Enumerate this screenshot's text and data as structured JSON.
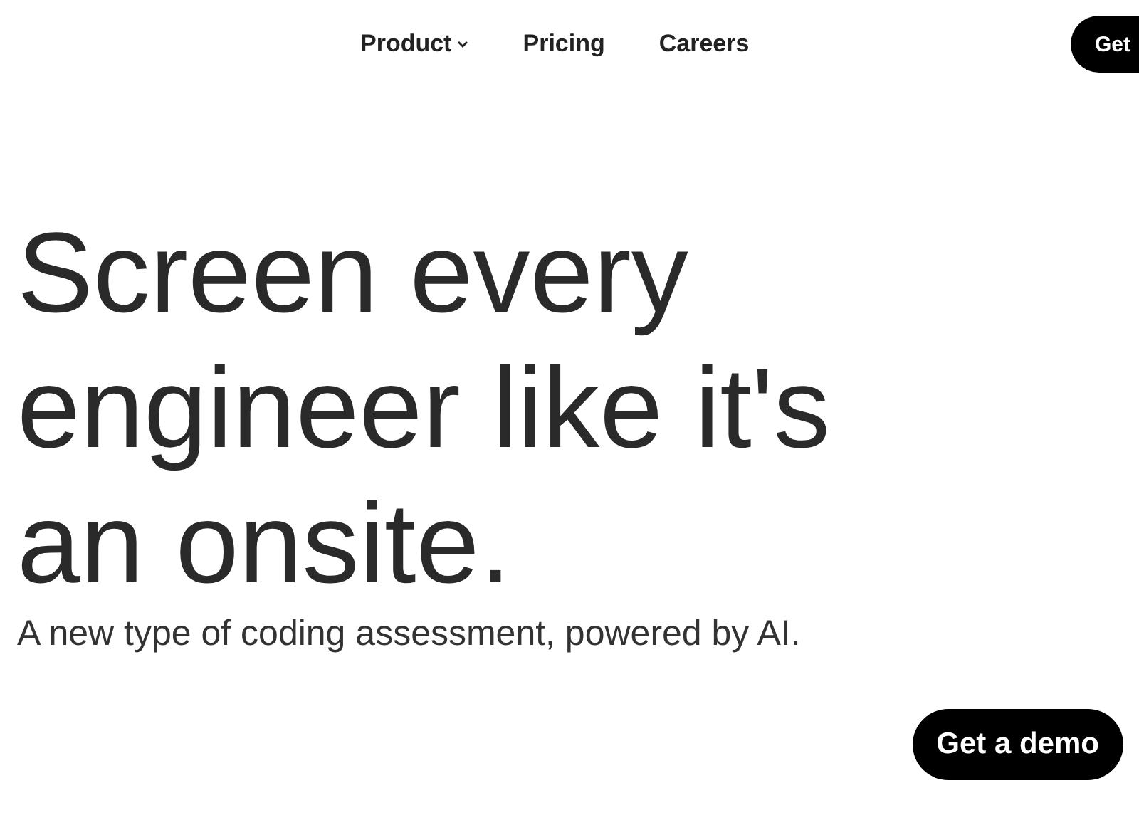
{
  "nav": {
    "items": [
      {
        "label": "Product",
        "kind": "dropdown"
      },
      {
        "label": "Pricing",
        "kind": "link"
      },
      {
        "label": "Careers",
        "kind": "link"
      }
    ],
    "cta": "Get"
  },
  "hero": {
    "headline": [
      "Screen every",
      "engineer like it's",
      "an onsite."
    ],
    "subtitle": "A new type of coding assessment, powered by AI.",
    "cta": "Get a demo"
  }
}
